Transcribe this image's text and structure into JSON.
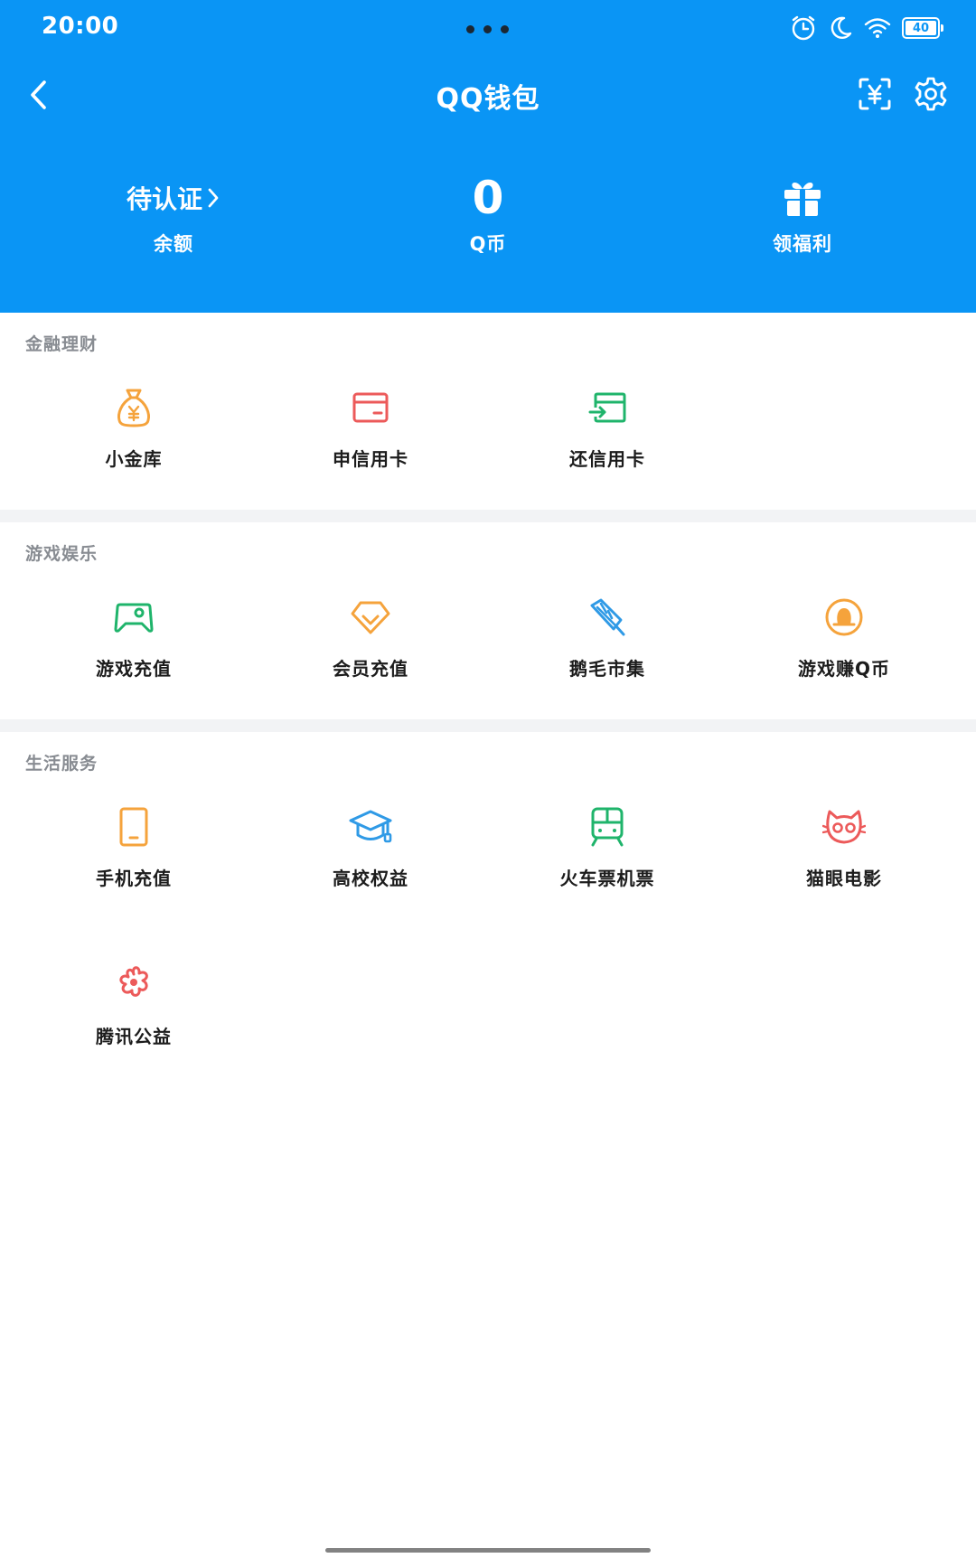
{
  "status_bar": {
    "time": "20:00",
    "battery": "40",
    "icons": [
      "alarm-icon",
      "moon-icon",
      "wifi-icon",
      "battery-icon"
    ]
  },
  "nav": {
    "title": "QQ钱包",
    "back_icon": "chevron-left-icon",
    "scan_icon": "scan-pay-icon",
    "settings_icon": "gear-icon"
  },
  "summary": {
    "auth": {
      "main": "待认证",
      "sub": "余额"
    },
    "qcoin": {
      "main": "0",
      "sub": "Q币"
    },
    "welfare": {
      "sub": "领福利",
      "icon": "gift-icon"
    }
  },
  "sections": {
    "finance": {
      "title": "金融理财",
      "items": [
        {
          "label": "小金库",
          "icon": "money-bag-icon",
          "color": "#f5a33c"
        },
        {
          "label": "申信用卡",
          "icon": "credit-card-icon",
          "color": "#ec5a5a"
        },
        {
          "label": "还信用卡",
          "icon": "card-repay-icon",
          "color": "#1fb46b"
        }
      ]
    },
    "games": {
      "title": "游戏娱乐",
      "items": [
        {
          "label": "游戏充值",
          "icon": "gamepad-icon",
          "color": "#1fb46b"
        },
        {
          "label": "会员充值",
          "icon": "diamond-icon",
          "color": "#f5a33c"
        },
        {
          "label": "鹅毛市集",
          "icon": "feather-tag-icon",
          "color": "#2f9ae6"
        },
        {
          "label": "游戏赚Q币",
          "icon": "penguin-coin-icon",
          "color": "#f5a33c"
        }
      ]
    },
    "life": {
      "title": "生活服务",
      "items": [
        {
          "label": "手机充值",
          "icon": "phone-icon",
          "color": "#f5a33c"
        },
        {
          "label": "高校权益",
          "icon": "graduation-cap-icon",
          "color": "#2f9ae6"
        },
        {
          "label": "火车票机票",
          "icon": "train-icon",
          "color": "#1fb46b"
        },
        {
          "label": "猫眼电影",
          "icon": "cat-eye-icon",
          "color": "#ec5a5a"
        },
        {
          "label": "腾讯公益",
          "icon": "flower-icon",
          "color": "#ec5a5a"
        }
      ]
    }
  },
  "colors": {
    "header_blue": "#0a95f5",
    "section_title": "#888c92",
    "divider": "#f2f3f5"
  }
}
